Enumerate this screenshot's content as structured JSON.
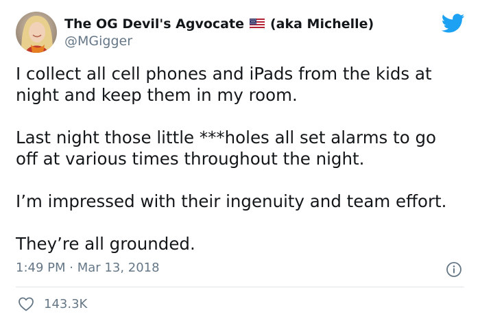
{
  "author": {
    "display_name": "The OG Devil's Agvocate",
    "display_name_suffix": "(aka Michelle)",
    "handle": "@MGigger",
    "flag_icon": "us-flag-icon"
  },
  "tweet": {
    "paragraphs": [
      {
        "lines": [
          "I collect all cell phones and iPads from the kids at",
          "night and keep them in my room."
        ]
      },
      {
        "lines": [
          "Last night those little ***holes all set alarms to go",
          "off at various times throughout the night."
        ]
      },
      {
        "lines": [
          "I’m impressed with their ingenuity and team effort."
        ]
      },
      {
        "lines": [
          "They’re all grounded."
        ]
      }
    ],
    "time": "1:49 PM",
    "separator": "·",
    "date": "Mar 13, 2018",
    "likes": "143.3K"
  },
  "icons": {
    "logo": "twitter-bird-icon",
    "info": "info-icon",
    "like": "heart-icon"
  },
  "colors": {
    "brand_blue": "#1da1f2",
    "text_primary": "#14171a",
    "text_secondary": "#657786",
    "divider": "#e1e8ed"
  }
}
